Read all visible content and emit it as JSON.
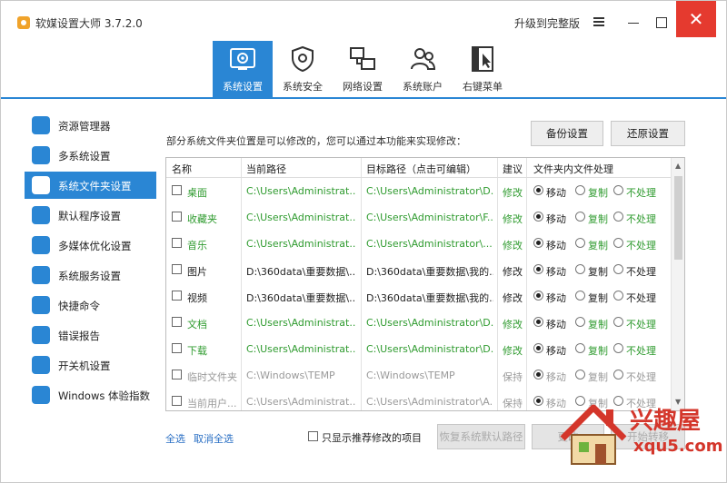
{
  "window": {
    "title": "软媒设置大师 3.7.2.0",
    "upgrade": "升级到完整版",
    "close_glyph": "✕"
  },
  "tabs": [
    {
      "label": "系统设置",
      "icon": "gear-icon",
      "active": true
    },
    {
      "label": "系统安全",
      "icon": "shield-icon",
      "active": false
    },
    {
      "label": "网络设置",
      "icon": "network-icon",
      "active": false
    },
    {
      "label": "系统账户",
      "icon": "users-icon",
      "active": false
    },
    {
      "label": "右键菜单",
      "icon": "cursor-icon",
      "active": false
    }
  ],
  "sidebar": {
    "items": [
      {
        "label": "资源管理器",
        "icon": "explorer-icon",
        "active": false
      },
      {
        "label": "多系统设置",
        "icon": "multi-system-icon",
        "active": false
      },
      {
        "label": "系统文件夹设置",
        "icon": "folder-settings-icon",
        "active": true
      },
      {
        "label": "默认程序设置",
        "icon": "default-program-icon",
        "active": false
      },
      {
        "label": "多媒体优化设置",
        "icon": "multimedia-icon",
        "active": false
      },
      {
        "label": "系统服务设置",
        "icon": "service-icon",
        "active": false
      },
      {
        "label": "快捷命令",
        "icon": "command-icon",
        "active": false
      },
      {
        "label": "错误报告",
        "icon": "report-icon",
        "active": false
      },
      {
        "label": "开关机设置",
        "icon": "power-icon",
        "active": false
      },
      {
        "label": "Windows 体验指数",
        "icon": "star-icon",
        "active": false
      }
    ]
  },
  "main": {
    "hint": "部分系统文件夹位置是可以修改的，您可以通过本功能来实现修改：",
    "backup_label": "备份设置",
    "restore_label": "还原设置",
    "columns": [
      "名称",
      "当前路径",
      "目标路径（点击可编辑）",
      "建议",
      "文件夹内文件处理"
    ],
    "options": [
      "移动",
      "复制",
      "不处理"
    ],
    "rows": [
      {
        "name": "桌面",
        "current": "C:\\Users\\Administrat...",
        "target": "C:\\Users\\Administrator\\D...",
        "advice": "修改",
        "style": "green"
      },
      {
        "name": "收藏夹",
        "current": "C:\\Users\\Administrat...",
        "target": "C:\\Users\\Administrator\\F...",
        "advice": "修改",
        "style": "green"
      },
      {
        "name": "音乐",
        "current": "C:\\Users\\Administrat...",
        "target": "C:\\Users\\Administrator\\...",
        "advice": "修改",
        "style": "green"
      },
      {
        "name": "图片",
        "current": "D:\\360data\\重要数据\\...",
        "target": "D:\\360data\\重要数据\\我的...",
        "advice": "修改",
        "style": "black"
      },
      {
        "name": "视频",
        "current": "D:\\360data\\重要数据\\...",
        "target": "D:\\360data\\重要数据\\我的...",
        "advice": "修改",
        "style": "black"
      },
      {
        "name": "文档",
        "current": "C:\\Users\\Administrat...",
        "target": "C:\\Users\\Administrator\\D...",
        "advice": "修改",
        "style": "green"
      },
      {
        "name": "下载",
        "current": "C:\\Users\\Administrat...",
        "target": "C:\\Users\\Administrator\\D...",
        "advice": "修改",
        "style": "green"
      },
      {
        "name": "临时文件夹",
        "current": "C:\\Windows\\TEMP",
        "target": "C:\\Windows\\TEMP",
        "advice": "保持",
        "style": "gray"
      },
      {
        "name": "当前用户...",
        "current": "C:\\Users\\Administrat...",
        "target": "C:\\Users\\Administrator\\A...",
        "advice": "保持",
        "style": "gray"
      }
    ]
  },
  "footer": {
    "select_all": "全选",
    "deselect_all": "取消全选",
    "only_recommended": "只显示推荐修改的项目",
    "restore_default": "恢复系统默认路径",
    "change_label": "更改",
    "start_move": "开始转移"
  },
  "watermark": {
    "text1": "兴趣屋",
    "text2": "xqu5.com"
  }
}
